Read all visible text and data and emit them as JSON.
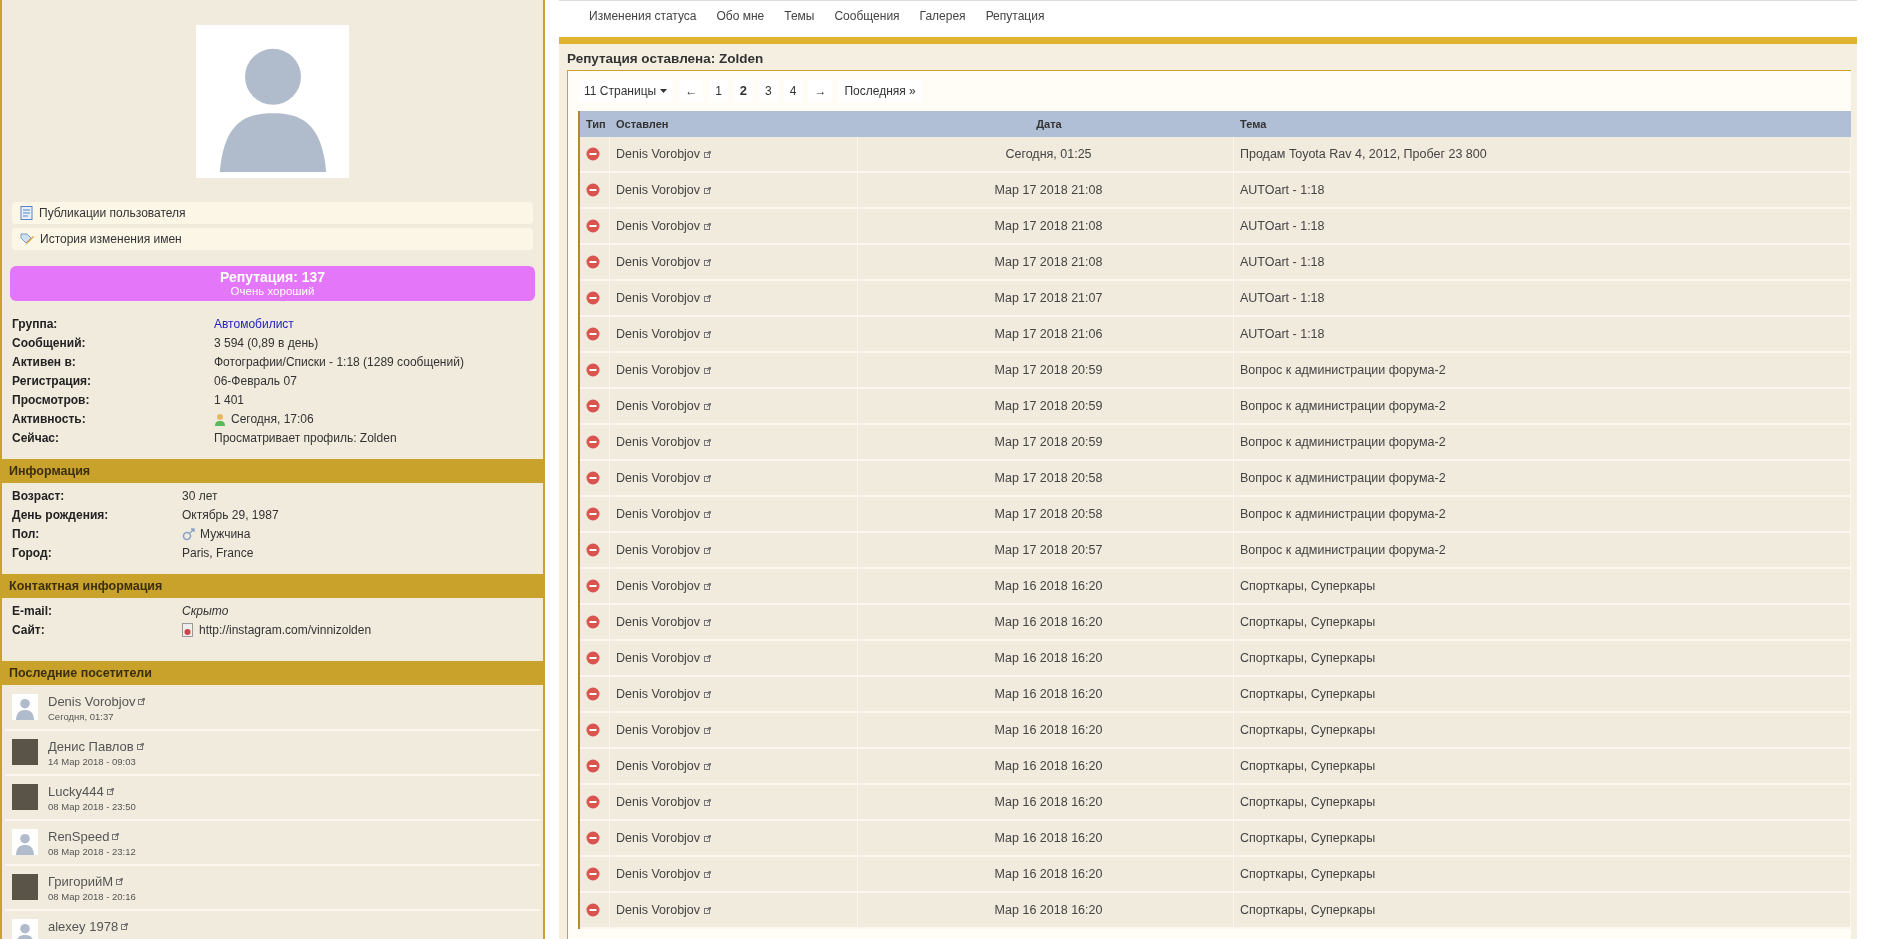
{
  "profile": {
    "links": [
      {
        "kind": "publications",
        "label": "Публикации пользователя"
      },
      {
        "kind": "names",
        "label": "История изменения имен"
      }
    ],
    "reputation": {
      "title": "Репутация: 137",
      "subtitle": "Очень хороший"
    },
    "stats": [
      {
        "label": "Группа:",
        "value": "Автомобилист",
        "kind": "link"
      },
      {
        "label": "Сообщений:",
        "value": "3 594 (0,89 в день)",
        "kind": "text"
      },
      {
        "label": "Активен в:",
        "value": "Фотографии/Списки - 1:18 (1289 сообщений)",
        "kind": "text"
      },
      {
        "label": "Регистрация:",
        "value": "06-Февраль 07",
        "kind": "text"
      },
      {
        "label": "Просмотров:",
        "value": "1 401",
        "kind": "text"
      },
      {
        "label": "Активность:",
        "value": "Сегодня, 17:06",
        "kind": "online"
      },
      {
        "label": "Сейчас:",
        "value": "Просматривает профиль: Zolden",
        "kind": "text"
      }
    ]
  },
  "information": {
    "title": "Информация",
    "rows": [
      {
        "label": "Возраст:",
        "value": "30 лет",
        "kind": "text"
      },
      {
        "label": "День рождения:",
        "value": "Октябрь 29, 1987",
        "kind": "text"
      },
      {
        "label": "Пол:",
        "value": "Мужчина",
        "kind": "gender"
      },
      {
        "label": "Город:",
        "value": "Paris, France",
        "kind": "text"
      }
    ]
  },
  "contact": {
    "title": "Контактная информация",
    "rows": [
      {
        "label": "E-mail:",
        "value": "Скрыто",
        "kind": "hidden"
      },
      {
        "label": "Сайт:",
        "value": "http://instagram.com/vinnizolden",
        "kind": "site"
      }
    ]
  },
  "visitors": {
    "title": "Последние посетители",
    "items": [
      {
        "name": "Denis Vorobjov",
        "time": "Сегодня, 01:37",
        "kind": "silhouette"
      },
      {
        "name": "Денис Павлов",
        "time": "14 Мар 2018 - 09:03",
        "kind": "photo"
      },
      {
        "name": "Lucky444",
        "time": "08 Мар 2018 - 23:50",
        "kind": "photo"
      },
      {
        "name": "RenSpeed",
        "time": "08 Мар 2018 - 23:12",
        "kind": "silhouette"
      },
      {
        "name": "ГригорийМ",
        "time": "08 Мар 2018 - 20:16",
        "kind": "photo"
      },
      {
        "name": "alexey 1978",
        "kind": "silhouette"
      }
    ]
  },
  "tabs": [
    "Изменения статуса",
    "Обо мне",
    "Темы",
    "Сообщения",
    "Галерея",
    "Репутация"
  ],
  "panel": {
    "title": "Репутация оставлена: Zolden",
    "pagination": {
      "pages_menu": "11 Страницы",
      "prev": "←",
      "next": "→",
      "last": "Последняя »",
      "pages": [
        {
          "label": "1",
          "selected": false
        },
        {
          "label": "2",
          "selected": true
        },
        {
          "label": "3",
          "selected": false
        },
        {
          "label": "4",
          "selected": false
        }
      ]
    },
    "columns": [
      "Тип",
      "Оставлен",
      "Дата",
      "Тема"
    ],
    "rows": [
      {
        "kind": "negative",
        "author": "Denis Vorobjov",
        "date": "Сегодня, 01:25",
        "topic": "Продам Toyota Rav 4, 2012, Пробег 23 800"
      },
      {
        "kind": "negative",
        "author": "Denis Vorobjov",
        "date": "Мар 17 2018 21:08",
        "topic": "AUTOart - 1:18"
      },
      {
        "kind": "negative",
        "author": "Denis Vorobjov",
        "date": "Мар 17 2018 21:08",
        "topic": "AUTOart - 1:18"
      },
      {
        "kind": "negative",
        "author": "Denis Vorobjov",
        "date": "Мар 17 2018 21:08",
        "topic": "AUTOart - 1:18"
      },
      {
        "kind": "negative",
        "author": "Denis Vorobjov",
        "date": "Мар 17 2018 21:07",
        "topic": "AUTOart - 1:18"
      },
      {
        "kind": "negative",
        "author": "Denis Vorobjov",
        "date": "Мар 17 2018 21:06",
        "topic": "AUTOart - 1:18"
      },
      {
        "kind": "negative",
        "author": "Denis Vorobjov",
        "date": "Мар 17 2018 20:59",
        "topic": "Вопрос к администрации форума-2"
      },
      {
        "kind": "negative",
        "author": "Denis Vorobjov",
        "date": "Мар 17 2018 20:59",
        "topic": "Вопрос к администрации форума-2"
      },
      {
        "kind": "negative",
        "author": "Denis Vorobjov",
        "date": "Мар 17 2018 20:59",
        "topic": "Вопрос к администрации форума-2"
      },
      {
        "kind": "negative",
        "author": "Denis Vorobjov",
        "date": "Мар 17 2018 20:58",
        "topic": "Вопрос к администрации форума-2"
      },
      {
        "kind": "negative",
        "author": "Denis Vorobjov",
        "date": "Мар 17 2018 20:58",
        "topic": "Вопрос к администрации форума-2"
      },
      {
        "kind": "negative",
        "author": "Denis Vorobjov",
        "date": "Мар 17 2018 20:57",
        "topic": "Вопрос к администрации форума-2"
      },
      {
        "kind": "negative",
        "author": "Denis Vorobjov",
        "date": "Мар 16 2018 16:20",
        "topic": "Спорткары, Суперкары"
      },
      {
        "kind": "negative",
        "author": "Denis Vorobjov",
        "date": "Мар 16 2018 16:20",
        "topic": "Спорткары, Суперкары"
      },
      {
        "kind": "negative",
        "author": "Denis Vorobjov",
        "date": "Мар 16 2018 16:20",
        "topic": "Спорткары, Суперкары"
      },
      {
        "kind": "negative",
        "author": "Denis Vorobjov",
        "date": "Мар 16 2018 16:20",
        "topic": "Спорткары, Суперкары"
      },
      {
        "kind": "negative",
        "author": "Denis Vorobjov",
        "date": "Мар 16 2018 16:20",
        "topic": "Спорткары, Суперкары"
      },
      {
        "kind": "negative",
        "author": "Denis Vorobjov",
        "date": "Мар 16 2018 16:20",
        "topic": "Спорткары, Суперкары"
      },
      {
        "kind": "negative",
        "author": "Denis Vorobjov",
        "date": "Мар 16 2018 16:20",
        "topic": "Спорткары, Суперкары"
      },
      {
        "kind": "negative",
        "author": "Denis Vorobjov",
        "date": "Мар 16 2018 16:20",
        "topic": "Спорткары, Суперкары"
      },
      {
        "kind": "negative",
        "author": "Denis Vorobjov",
        "date": "Мар 16 2018 16:20",
        "topic": "Спорткары, Суперкары"
      },
      {
        "kind": "negative",
        "author": "Denis Vorobjov",
        "date": "Мар 16 2018 16:20",
        "topic": "Спорткары, Суперкары"
      }
    ]
  }
}
